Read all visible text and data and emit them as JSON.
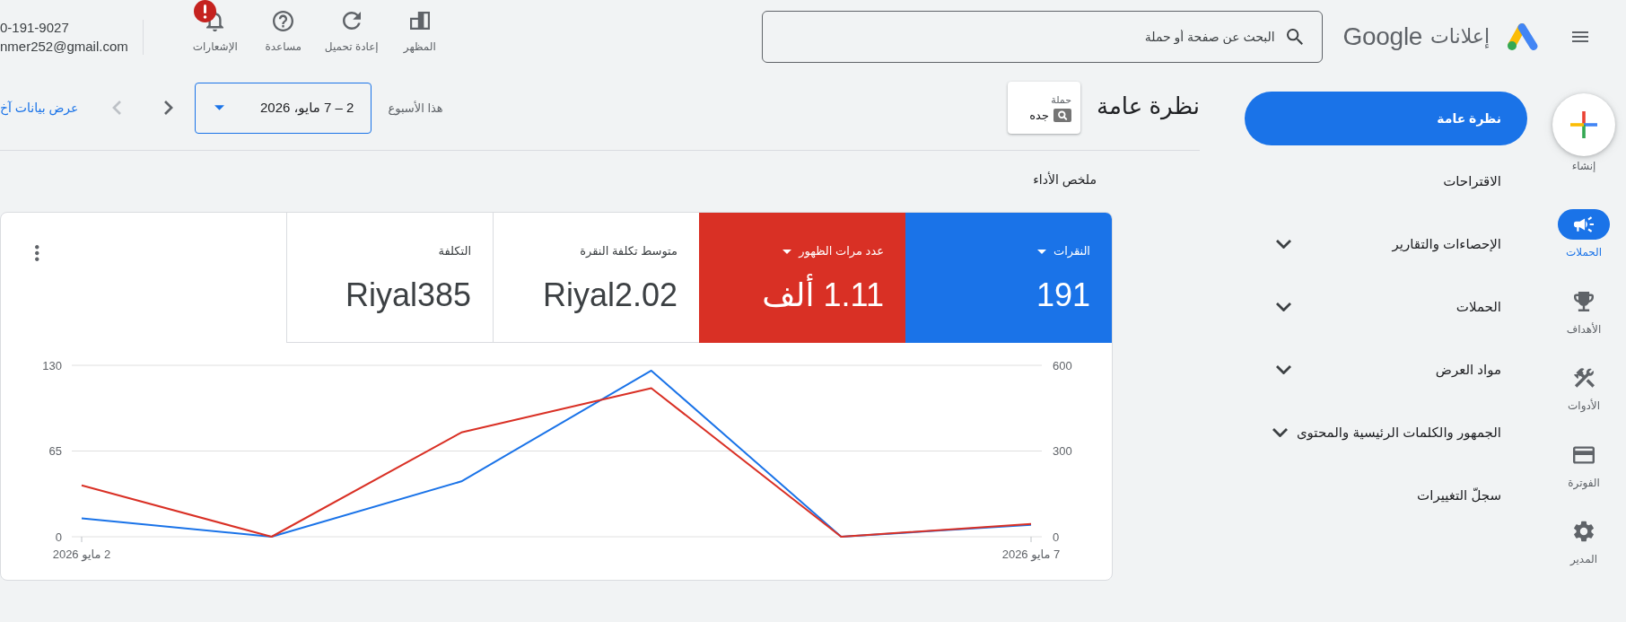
{
  "header": {
    "brand": {
      "product": "إعلانات",
      "wordmark": "Google"
    },
    "search": {
      "placeholder": "البحث عن صفحة أو حملة"
    },
    "tools": [
      {
        "label": "المظهر",
        "alert": false
      },
      {
        "label": "إعادة تحميل",
        "alert": false
      },
      {
        "label": "مساعدة",
        "alert": false
      },
      {
        "label": "الإشعارات",
        "alert": true
      }
    ],
    "account": {
      "phone": "0-191-9027",
      "email": "nmer252@gmail.com"
    }
  },
  "rail": {
    "create": {
      "label": "إنشاء"
    },
    "items": [
      {
        "label": "الحملات",
        "selected": true
      },
      {
        "label": "الأهداف",
        "selected": false
      },
      {
        "label": "الأدوات",
        "selected": false
      },
      {
        "label": "الفوترة",
        "selected": false
      },
      {
        "label": "المدير",
        "selected": false
      }
    ]
  },
  "nav": [
    {
      "kind": "link",
      "label": "نظرة عامة",
      "selected": true
    },
    {
      "kind": "link",
      "label": "الاقتراحات",
      "selected": false
    },
    {
      "kind": "section",
      "label": "الإحصاءات والتقارير",
      "selected": false,
      "expanded": false
    },
    {
      "kind": "section",
      "label": "الحملات",
      "selected": false,
      "expanded": false
    },
    {
      "kind": "section",
      "label": "مواد العرض",
      "selected": false,
      "expanded": false
    },
    {
      "kind": "section",
      "label": "الجمهور والكلمات الرئيسية والمحتوى",
      "selected": false,
      "expanded": false
    },
    {
      "kind": "link",
      "label": "سجلّ التغييرات",
      "selected": false
    }
  ],
  "page": {
    "title": "نظرة عامة",
    "campaign_picker": {
      "label": "حملة",
      "value": "جده"
    },
    "date_range": {
      "label": "هذا الأسبوع",
      "value": "2 – 7 مايو، 2026"
    },
    "arrow_buttons": [
      {
        "disabled": false
      },
      {
        "disabled": true
      }
    ],
    "link": "عرض بيانات آخ"
  },
  "summary": {
    "title": "ملخص الأداء",
    "metrics": [
      {
        "label": "النقرات",
        "value": "191",
        "selected": true,
        "color": "#1a73e8"
      },
      {
        "label": "عدد مرات الظهور",
        "value": "1.11 ألف",
        "selected": true,
        "color": "#d93025"
      },
      {
        "label": "متوسط تكلفة النقرة",
        "value": "Riyal2.02",
        "selected": false
      },
      {
        "label": "التكلفة",
        "value": "Riyal385",
        "selected": false
      }
    ],
    "chart_data": {
      "type": "line",
      "categories": [
        "2 مايو 2026",
        null,
        null,
        null,
        null,
        "7 مايو 2026"
      ],
      "ylim": [
        0,
        130
      ],
      "yticks": [
        0,
        65,
        130
      ],
      "y2lim": [
        0,
        600
      ],
      "y2ticks": [
        0,
        300,
        600
      ],
      "series": [
        {
          "color": "#1a73e8",
          "values": [
            14,
            0,
            42,
            126,
            0,
            9
          ]
        },
        {
          "axis": "y2",
          "color": "#d93025",
          "values": [
            180,
            0,
            365,
            520,
            0,
            45
          ]
        }
      ]
    }
  }
}
